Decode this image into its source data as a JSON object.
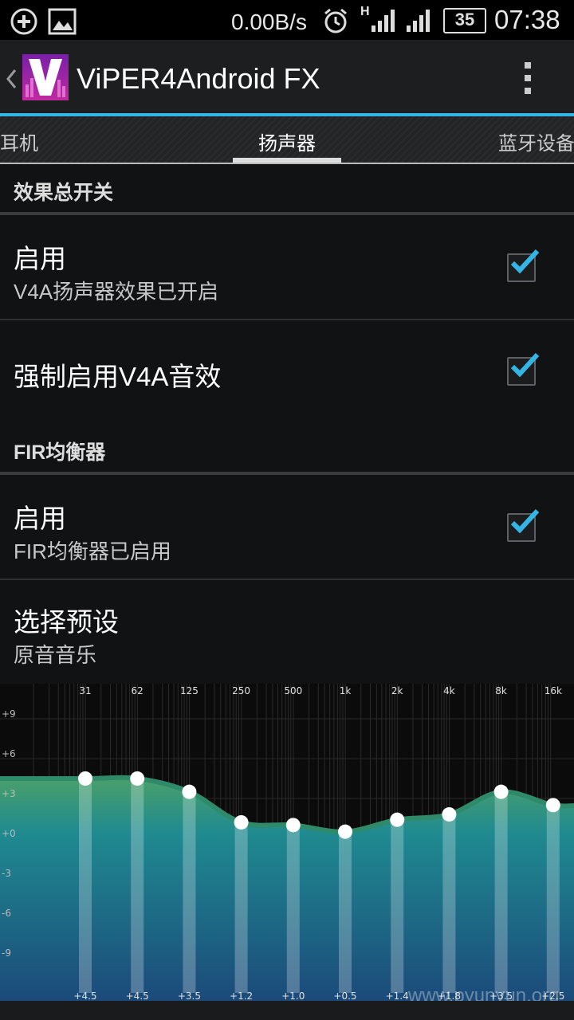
{
  "status_bar": {
    "network_speed": "0.00B/s",
    "signal_type": "H",
    "battery": "35",
    "time": "07:38"
  },
  "action_bar": {
    "title": "ViPER4Android FX"
  },
  "tabs": [
    {
      "label": "耳机",
      "active": false
    },
    {
      "label": "扬声器",
      "active": true
    },
    {
      "label": "蓝牙设备",
      "active": false
    }
  ],
  "sections": {
    "master": {
      "header": "效果总开关",
      "enable": {
        "title": "启用",
        "summary": "V4A扬声器效果已开启",
        "checked": true
      },
      "force": {
        "title": "强制启用V4A音效",
        "checked": true
      }
    },
    "fir": {
      "header": "FIR均衡器",
      "enable": {
        "title": "启用",
        "summary": "FIR均衡器已启用",
        "checked": true
      },
      "preset": {
        "title": "选择预设",
        "summary": "原音音乐"
      }
    }
  },
  "chart_data": {
    "type": "line",
    "x": [
      "31",
      "62",
      "125",
      "250",
      "500",
      "1k",
      "2k",
      "4k",
      "8k",
      "16k"
    ],
    "series": [
      {
        "values": [
          4.5,
          4.5,
          3.5,
          1.2,
          1.0,
          0.5,
          1.4,
          1.8,
          3.5,
          2.5
        ]
      }
    ],
    "value_labels": [
      "+4.5",
      "+4.5",
      "+3.5",
      "+1.2",
      "+1.0",
      "+0.5",
      "+1.4",
      "+1.8",
      "+3.5",
      "+2.5"
    ],
    "y_ticks": [
      "+9",
      "+6",
      "+3",
      "+0",
      "-3",
      "-6",
      "-9"
    ],
    "y_tick_values": [
      9,
      6,
      3,
      0,
      -3,
      -6,
      -9
    ],
    "ylim": [
      -12,
      12
    ],
    "grid": true,
    "colors": {
      "fill_top": "#4aa06a",
      "fill_bottom": "#1b4a7a",
      "curve": "#2f8a6a"
    }
  },
  "watermark": "www.pyunyun.org"
}
